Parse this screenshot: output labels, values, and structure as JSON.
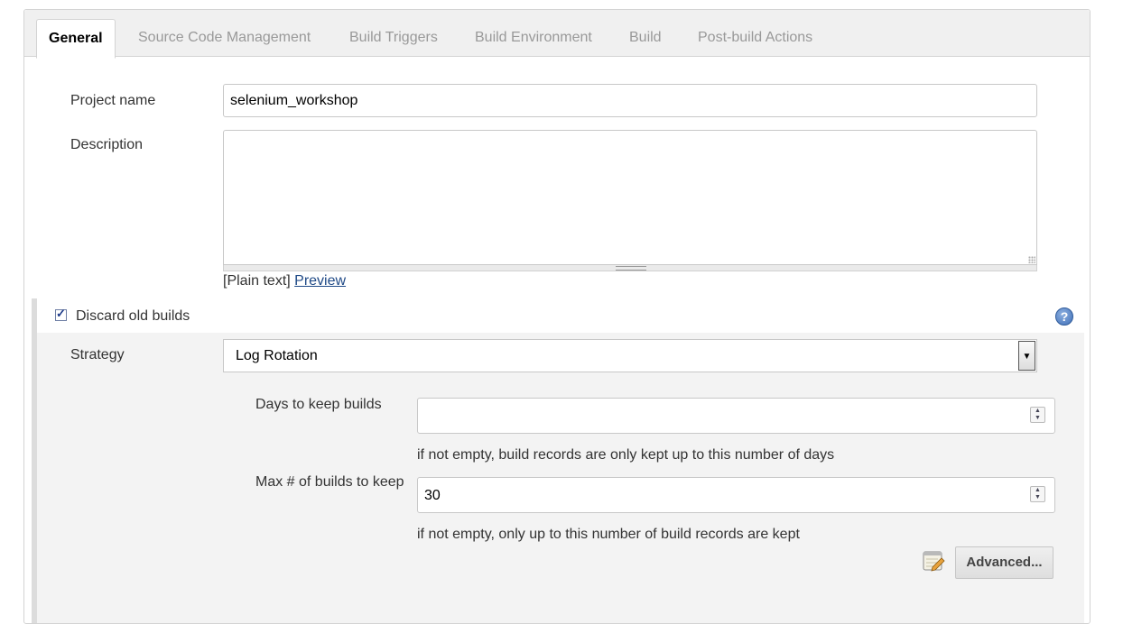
{
  "tabs": [
    {
      "label": "General",
      "active": true
    },
    {
      "label": "Source Code Management"
    },
    {
      "label": "Build Triggers"
    },
    {
      "label": "Build Environment"
    },
    {
      "label": "Build"
    },
    {
      "label": "Post-build Actions"
    }
  ],
  "general": {
    "project_name_label": "Project name",
    "project_name_value": "selenium_workshop",
    "description_label": "Description",
    "description_value": "",
    "plain_text": "[Plain text]",
    "preview_link": "Preview"
  },
  "discard": {
    "checkbox_label": "Discard old builds",
    "checked": true,
    "help_icon": "help-icon",
    "strategy_label": "Strategy",
    "strategy_value": "Log Rotation",
    "days_label": "Days to keep builds",
    "days_value": "",
    "days_hint": "if not empty, build records are only kept up to this number of days",
    "max_label": "Max # of builds to keep",
    "max_value": "30",
    "max_hint": "if not empty, only up to this number of build records are kept",
    "advanced_button": "Advanced...",
    "advanced_icon": "notepad-icon"
  },
  "colors": {
    "link": "#204a87",
    "help_icon": "#3f6fb8",
    "section_bg": "#f3f3f3"
  }
}
